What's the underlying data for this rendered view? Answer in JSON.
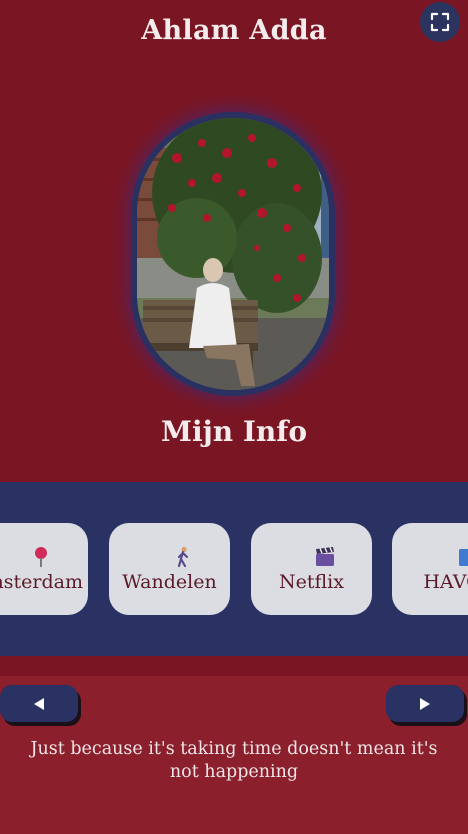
{
  "header": {
    "title": "Ahlam Adda"
  },
  "profile": {
    "photo_description": "Profile photo"
  },
  "section": {
    "title": "Mijn Info"
  },
  "cards": [
    {
      "label": "Amsterdam",
      "icon": "pin-icon"
    },
    {
      "label": "Wandelen",
      "icon": "walking-icon"
    },
    {
      "label": "Netflix",
      "icon": "clapper-icon"
    },
    {
      "label": "HAVO",
      "icon": "book-icon"
    }
  ],
  "controls": {
    "prev_icon": "triangle-left-icon",
    "next_icon": "triangle-right-icon",
    "fullscreen_icon": "fullscreen-icon"
  },
  "quote": {
    "text": "Just because it's taking time doesn't mean it's not happening"
  },
  "colors": {
    "background": "#7a1624",
    "band": "#2a3163",
    "card": "#dcdde3",
    "bottom_panel": "#8b1f2c",
    "text_light": "#f4ecec"
  }
}
